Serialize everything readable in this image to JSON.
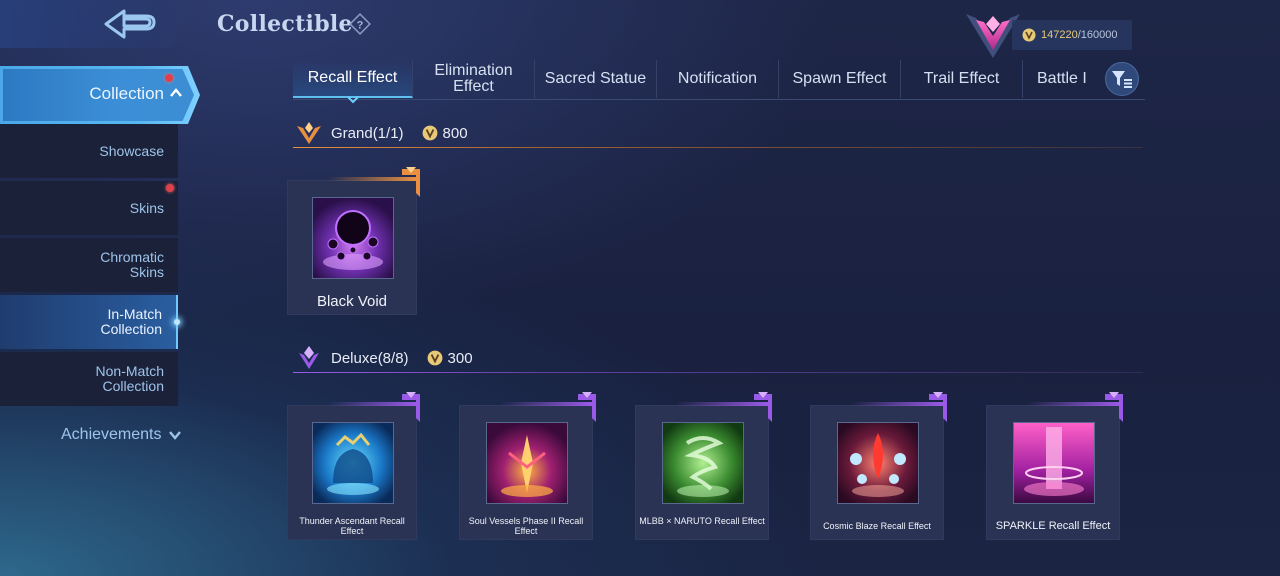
{
  "header": {
    "title": "Collectible",
    "currency_current": "147220",
    "currency_max": "/160000"
  },
  "sidebar": {
    "collection_label": "Collection",
    "items": [
      {
        "label_line1": "Showcase",
        "label_line2": ""
      },
      {
        "label_line1": "Skins",
        "label_line2": ""
      },
      {
        "label_line1": "Chromatic",
        "label_line2": "Skins"
      },
      {
        "label_line1": "In-Match",
        "label_line2": "Collection"
      },
      {
        "label_line1": "Non-Match",
        "label_line2": "Collection"
      }
    ],
    "achievements_label": "Achievements"
  },
  "tabs": [
    {
      "line1": "Recall Effect",
      "line2": ""
    },
    {
      "line1": "Elimination",
      "line2": "Effect"
    },
    {
      "line1": "Sacred Statue",
      "line2": ""
    },
    {
      "line1": "Notification",
      "line2": ""
    },
    {
      "line1": "Spawn Effect",
      "line2": ""
    },
    {
      "line1": "Trail Effect",
      "line2": ""
    },
    {
      "line1": "Battle I",
      "line2": ""
    }
  ],
  "sections": {
    "grand": {
      "label": "Grand(1/1)",
      "price": "800",
      "items": [
        {
          "name": "Black Void"
        }
      ]
    },
    "deluxe": {
      "label": "Deluxe(8/8)",
      "price": "300",
      "items": [
        {
          "name": "Thunder Ascendant Recall Effect"
        },
        {
          "name": "Soul Vessels Phase II Recall Effect"
        },
        {
          "name": "MLBB × NARUTO Recall Effect"
        },
        {
          "name": "Cosmic Blaze Recall Effect"
        },
        {
          "name": "SPARKLE Recall Effect"
        }
      ]
    }
  },
  "colors": {
    "accent_blue": "#4aa8e8",
    "grand_orange": "#e89040",
    "deluxe_purple": "#9a5ae8",
    "coin_gold": "#e8c977"
  }
}
